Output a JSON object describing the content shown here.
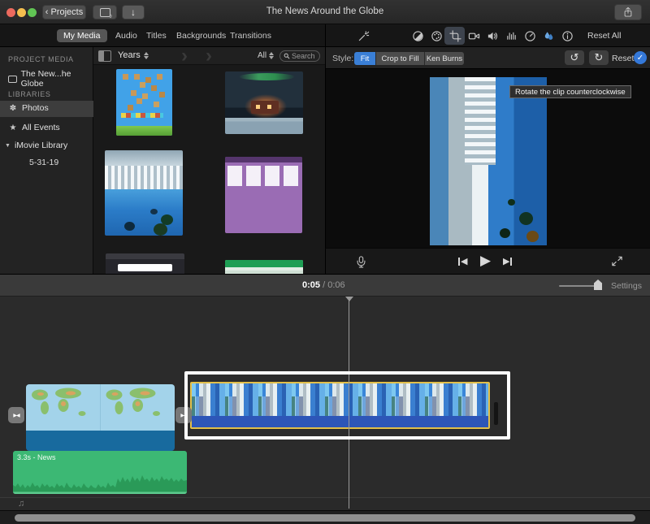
{
  "titlebar": {
    "back_glyph": "‹",
    "projects": "Projects",
    "import_glyph": "↓",
    "media_note_glyph": "♪",
    "title": "The News Around the Globe"
  },
  "tabs": {
    "items": [
      "My Media",
      "Audio",
      "Titles",
      "Backgrounds",
      "Transitions"
    ],
    "selected": "My Media"
  },
  "adjustbar": {
    "icons": [
      "enhance-wand",
      "color-balance",
      "color-correction",
      "crop",
      "stabilization",
      "volume",
      "equalizer",
      "speed",
      "video-effects",
      "info"
    ],
    "reset_all": "Reset All"
  },
  "sidebar": {
    "project_media_header": "PROJECT MEDIA",
    "project_item": "The New...he Globe",
    "libraries_header": "LIBRARIES",
    "photos": "Photos",
    "all_events": "All Events",
    "imovie_library": "iMovie Library",
    "event_date": "5-31-19",
    "disclosure_glyph": "▼",
    "flower_glyph": "✽",
    "star_glyph": "★"
  },
  "browser": {
    "group_by": "Years",
    "chevron_glyph": "›",
    "filter_all": "All",
    "search_placeholder": "Search",
    "thumbnails": [
      "game-screenshot",
      "winter-cabin",
      "waterfall-photo",
      "purple-board-window",
      "dark-browser-window",
      "green-spreadsheet-window"
    ]
  },
  "stylebar": {
    "label": "Style:",
    "fit": "Fit",
    "crop_to_fill": "Crop to Fill",
    "ken_burns": "Ken Burns",
    "selected": "Fit",
    "rotate_ccw_glyph": "↺",
    "rotate_cw_glyph": "↻",
    "reset": "Reset",
    "check_glyph": "✓"
  },
  "tooltip": {
    "text": "Rotate the clip counterclockwise"
  },
  "playback": {
    "play_glyph": "▶",
    "back_glyph": "◀",
    "fwd_glyph": "▶",
    "icons": [
      "voiceover-mic",
      "skip-back",
      "play",
      "skip-forward",
      "fullscreen"
    ]
  },
  "timeline": {
    "current_time": "0:05",
    "time_separator": " / ",
    "total_time": "0:06",
    "settings": "Settings",
    "audio_clip_label": "3.3s - News",
    "transition_glyph": "▶◀",
    "music_note_glyph": "♫",
    "clips": [
      "world-map-video-clip",
      "news-audio-clip",
      "waterfall-clip-selected"
    ]
  },
  "colors": {
    "accent_blue": "#3a7fd6",
    "selection_yellow": "#e2bf4a",
    "audio_green": "#3cb874",
    "check_blue": "#3478d8",
    "traffic_red": "#ec6a5e",
    "traffic_yellow": "#f5bf4f",
    "traffic_green": "#61c554"
  }
}
